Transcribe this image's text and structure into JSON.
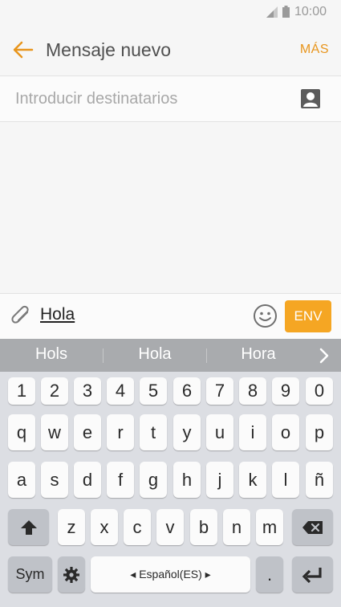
{
  "status_bar": {
    "time": "10:00"
  },
  "app_bar": {
    "title": "Mensaje nuevo",
    "more_label": "MÁS"
  },
  "recipients": {
    "placeholder": "Introducir destinatarios"
  },
  "composer": {
    "text": "Hola",
    "send_label": "ENV"
  },
  "suggestions": [
    "Hols",
    "Hola",
    "Hora"
  ],
  "keyboard": {
    "row1": [
      "1",
      "2",
      "3",
      "4",
      "5",
      "6",
      "7",
      "8",
      "9",
      "0"
    ],
    "row2": [
      "q",
      "w",
      "e",
      "r",
      "t",
      "y",
      "u",
      "i",
      "o",
      "p"
    ],
    "row3": [
      "a",
      "s",
      "d",
      "f",
      "g",
      "h",
      "j",
      "k",
      "l",
      "ñ"
    ],
    "row4": [
      "z",
      "x",
      "c",
      "v",
      "b",
      "n",
      "m"
    ],
    "sym_label": "Sym",
    "space_label": "◂ Español(ES) ▸",
    "period_label": "."
  },
  "colors": {
    "accent": "#f5a623",
    "accent_text": "#e8951c"
  }
}
